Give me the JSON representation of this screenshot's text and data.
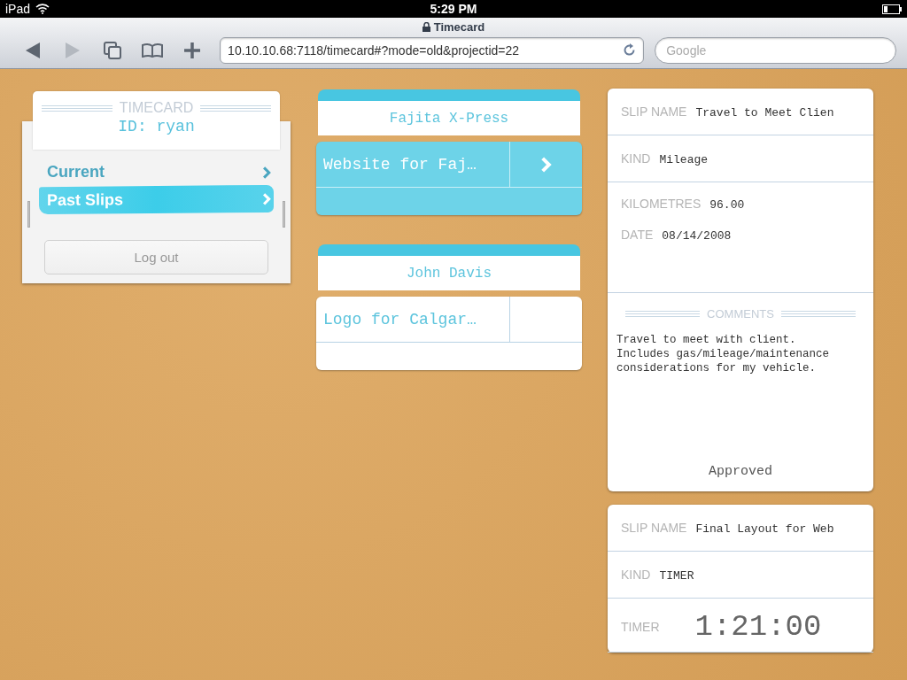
{
  "status_bar": {
    "device": "iPad",
    "time": "5:29 PM"
  },
  "browser": {
    "page_title": "Timecard",
    "url": "10.10.10.68:7118/timecard#?mode=old&projectid=22",
    "search": {
      "placeholder": "Google"
    }
  },
  "timecard": {
    "title": "TIMECARD",
    "user_id": "ID: ryan",
    "menu": [
      {
        "label": "Current",
        "selected": false
      },
      {
        "label": "Past Slips",
        "selected": true
      }
    ],
    "logout": "Log out"
  },
  "projects": [
    {
      "client": "Fajita X-Press",
      "tasks": [
        {
          "name": "Website for Faj…",
          "selected": true
        }
      ]
    },
    {
      "client": "John Davis",
      "tasks": [
        {
          "name": "Logo for Calgar…",
          "selected": false
        }
      ]
    }
  ],
  "slips": [
    {
      "sections": [
        [
          {
            "kind": "field",
            "label": "SLIP NAME",
            "value": "Travel to Meet Clien"
          }
        ],
        [
          {
            "kind": "field",
            "label": "KIND",
            "value": "Mileage"
          }
        ],
        [
          {
            "kind": "field",
            "label": "KILOMETRES",
            "value": "96.00"
          },
          {
            "kind": "field",
            "label": "DATE",
            "value": "08/14/2008"
          }
        ]
      ],
      "comments": {
        "heading": "COMMENTS",
        "text": "Travel to meet with client.\nIncludes gas/mileage/maintenance\nconsiderations for my vehicle.",
        "status": "Approved"
      }
    },
    {
      "sections": [
        [
          {
            "kind": "field",
            "label": "SLIP NAME",
            "value": "Final Layout for Web"
          }
        ],
        [
          {
            "kind": "field",
            "label": "KIND",
            "value": "TIMER"
          }
        ],
        [
          {
            "kind": "timer",
            "label": "TIMER",
            "value": "1:21:00"
          }
        ]
      ]
    }
  ]
}
